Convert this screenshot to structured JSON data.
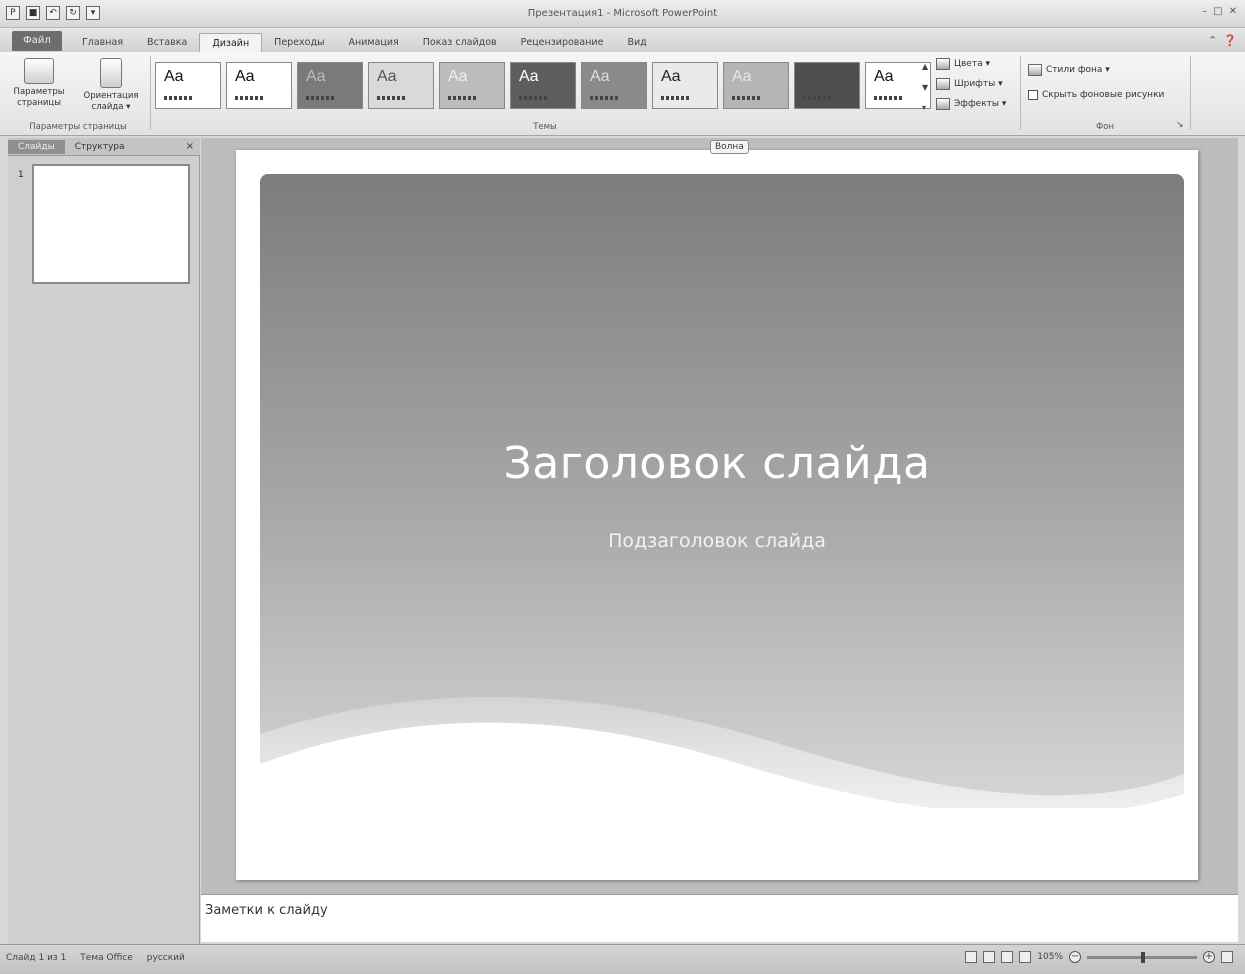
{
  "window": {
    "title": "Презентация1 - Microsoft PowerPoint",
    "controls": [
      "–",
      "□",
      "✕"
    ]
  },
  "ribbon_tabs": {
    "file": "Файл",
    "tabs": [
      "Главная",
      "Вставка",
      "Дизайн",
      "Переходы",
      "Анимация",
      "Показ слайдов",
      "Рецензирование",
      "Вид"
    ],
    "active_index": 2
  },
  "ribbon": {
    "page_setup": {
      "page_params_label": "Параметры страницы",
      "orientation_label": "Ориентация слайда ▾",
      "group_label": "Параметры страницы"
    },
    "themes": {
      "group_label": "Темы",
      "items": [
        {
          "aa": "Aa",
          "bg": "#ffffff",
          "fg": "#111111"
        },
        {
          "aa": "Aa",
          "bg": "#ffffff",
          "fg": "#111111"
        },
        {
          "aa": "Aa",
          "bg": "#7a7a7a",
          "fg": "#bbbbbb"
        },
        {
          "aa": "Aa",
          "bg": "#d9d9d9",
          "fg": "#555555"
        },
        {
          "aa": "Aa",
          "bg": "#bdbdbd",
          "fg": "#eeeeee"
        },
        {
          "aa": "Aa",
          "bg": "#5e5e5e",
          "fg": "#ffffff"
        },
        {
          "aa": "Aa",
          "bg": "#8a8a8a",
          "fg": "#dddddd"
        },
        {
          "aa": "Aa",
          "bg": "#eaeaea",
          "fg": "#222222"
        },
        {
          "aa": "Aa",
          "bg": "#b5b5b5",
          "fg": "#e6e6e6"
        },
        {
          "aa": "",
          "bg": "#4f4f4f",
          "fg": "#ffffff"
        },
        {
          "aa": "Aa",
          "bg": "#ffffff",
          "fg": "#111111"
        }
      ],
      "colors_label": "Цвета ▾",
      "fonts_label": "Шрифты ▾",
      "effects_label": "Эффекты ▾"
    },
    "background": {
      "group_label": "Фон",
      "styles_label": "Стили фона ▾",
      "hide_graphics_label": "Скрыть фоновые рисунки"
    }
  },
  "left_panel": {
    "tabs": [
      "Слайды",
      "Структура"
    ],
    "active_index": 0,
    "close": "×",
    "slide_number": "1"
  },
  "slide": {
    "title": "Заголовок слайда",
    "subtitle": "Подзаголовок слайда",
    "theme_tooltip": "Волна"
  },
  "notes": {
    "placeholder": "Заметки к слайду"
  },
  "status": {
    "slide_info": "Слайд 1 из 1",
    "theme": "Тема Office",
    "language": "русский",
    "zoom": "105%",
    "zoom_minus": "−",
    "zoom_plus": "+"
  }
}
